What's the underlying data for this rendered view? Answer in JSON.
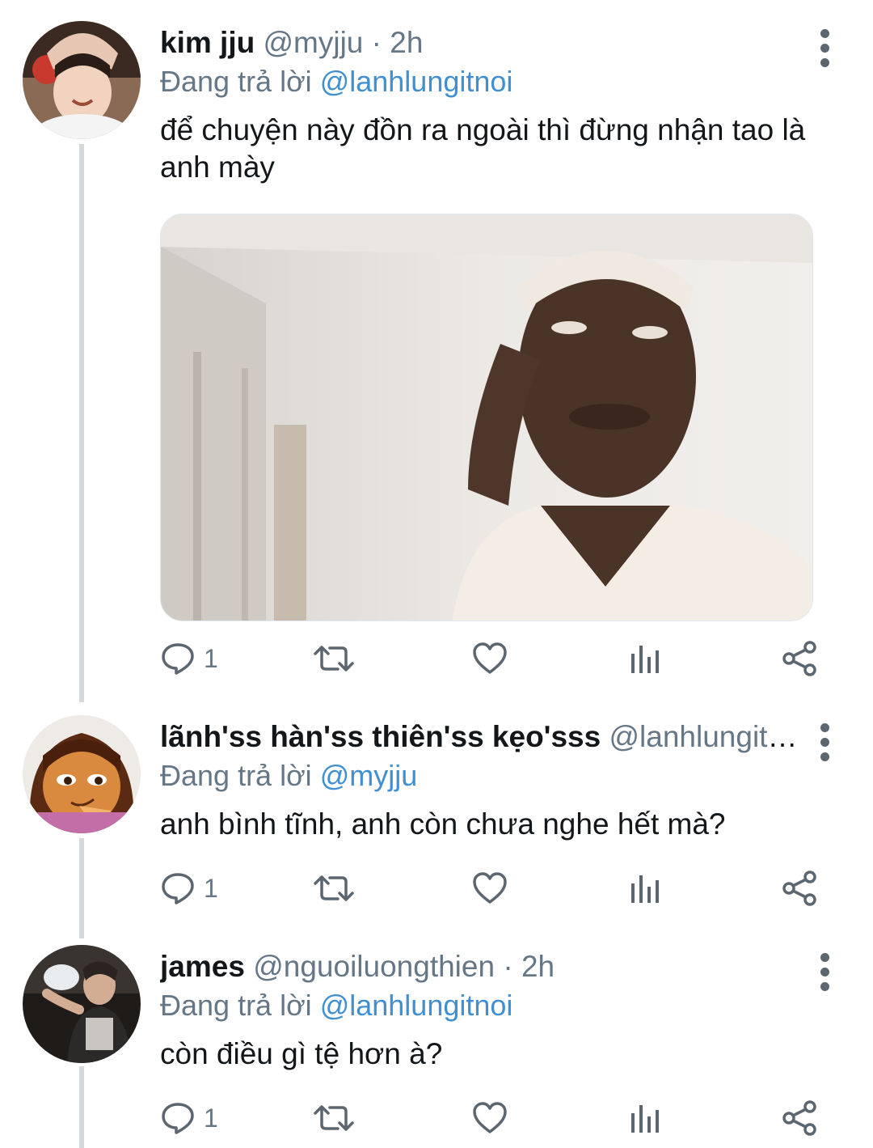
{
  "colors": {
    "text": "#14171a",
    "secondary": "#657786",
    "mention": "#3f8fd2",
    "thread_line": "#d4d9de",
    "icon": "#5c6670"
  },
  "tweets": [
    {
      "display_name": "kim jju",
      "handle": "@myjju",
      "separator": "·",
      "time": "2h",
      "reply_prefix": "Đang trả lời ",
      "reply_to": "@lanhlungitnoi",
      "text": "để chuyện này đồn ra ngoài thì đừng nhận tao là anh mày",
      "has_media": true,
      "reply_count": "1",
      "icons": [
        "reply-icon",
        "retweet-icon",
        "like-icon",
        "analytics-icon",
        "share-icon"
      ]
    },
    {
      "display_name": "lãnh'ss hàn'ss thiên'ss kẹo'sss",
      "handle": "@lanhlungitn...",
      "reply_prefix": "Đang trả lời ",
      "reply_to": "@myjju",
      "text": "anh bình tĩnh, anh còn chưa nghe hết mà?",
      "has_media": false,
      "reply_count": "1",
      "icons": [
        "reply-icon",
        "retweet-icon",
        "like-icon",
        "analytics-icon",
        "share-icon"
      ]
    },
    {
      "display_name": "james",
      "handle": "@nguoiluongthien",
      "separator": "·",
      "time": "2h",
      "reply_prefix": "Đang trả lời ",
      "reply_to": "@lanhlungitnoi",
      "text": "còn điều gì tệ hơn à?",
      "has_media": false,
      "reply_count": "1",
      "icons": [
        "reply-icon",
        "retweet-icon",
        "like-icon",
        "analytics-icon",
        "share-icon"
      ]
    }
  ]
}
